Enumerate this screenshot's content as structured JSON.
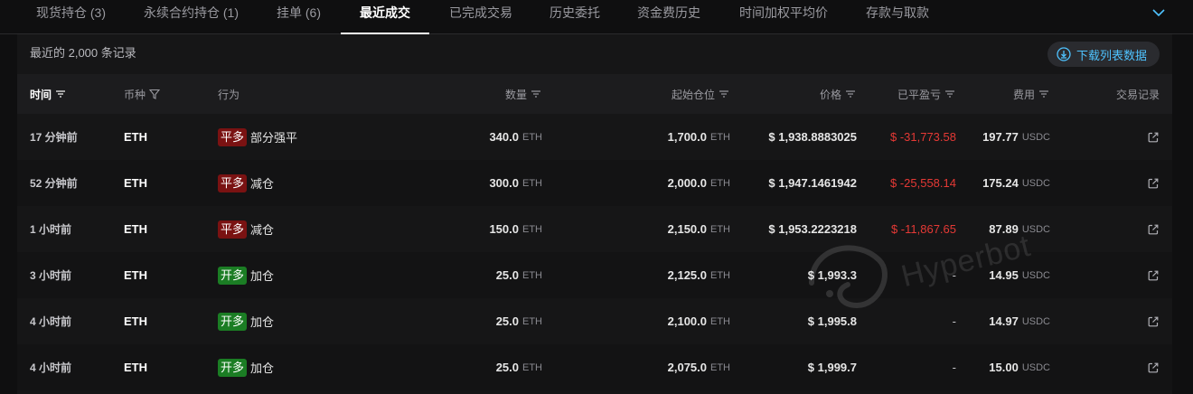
{
  "tabs": [
    {
      "label": "现货持仓 (3)",
      "active": false
    },
    {
      "label": "永续合约持仓 (1)",
      "active": false
    },
    {
      "label": "挂单 (6)",
      "active": false
    },
    {
      "label": "最近成交",
      "active": true
    },
    {
      "label": "已完成交易",
      "active": false
    },
    {
      "label": "历史委托",
      "active": false
    },
    {
      "label": "资金费历史",
      "active": false
    },
    {
      "label": "时间加权平均价",
      "active": false
    },
    {
      "label": "存款与取款",
      "active": false
    }
  ],
  "records_count": "最近的 2,000 条记录",
  "download_label": "下载列表数据",
  "columns": {
    "time": "时间",
    "coin": "币种",
    "action": "行为",
    "quantity": "数量",
    "start_position": "起始仓位",
    "price": "价格",
    "pnl": "已平盈亏",
    "fee": "费用",
    "trade_log": "交易记录"
  },
  "rows": [
    {
      "time": "17 分钟前",
      "coin": "ETH",
      "badge": "平多",
      "badge_type": "close",
      "action": "部分强平",
      "qty": "340.0",
      "qty_unit": "ETH",
      "start": "1,700.0",
      "start_unit": "ETH",
      "price": "$ 1,938.8883025",
      "pnl": "$ -31,773.58",
      "fee": "197.77",
      "fee_unit": "USDC"
    },
    {
      "time": "52 分钟前",
      "coin": "ETH",
      "badge": "平多",
      "badge_type": "close",
      "action": "减仓",
      "qty": "300.0",
      "qty_unit": "ETH",
      "start": "2,000.0",
      "start_unit": "ETH",
      "price": "$ 1,947.1461942",
      "pnl": "$ -25,558.14",
      "fee": "175.24",
      "fee_unit": "USDC"
    },
    {
      "time": "1 小时前",
      "coin": "ETH",
      "badge": "平多",
      "badge_type": "close",
      "action": "减仓",
      "qty": "150.0",
      "qty_unit": "ETH",
      "start": "2,150.0",
      "start_unit": "ETH",
      "price": "$ 1,953.2223218",
      "pnl": "$ -11,867.65",
      "fee": "87.89",
      "fee_unit": "USDC"
    },
    {
      "time": "3 小时前",
      "coin": "ETH",
      "badge": "开多",
      "badge_type": "open",
      "action": "加仓",
      "qty": "25.0",
      "qty_unit": "ETH",
      "start": "2,125.0",
      "start_unit": "ETH",
      "price": "$ 1,993.3",
      "pnl": "-",
      "fee": "14.95",
      "fee_unit": "USDC"
    },
    {
      "time": "4 小时前",
      "coin": "ETH",
      "badge": "开多",
      "badge_type": "open",
      "action": "加仓",
      "qty": "25.0",
      "qty_unit": "ETH",
      "start": "2,100.0",
      "start_unit": "ETH",
      "price": "$ 1,995.8",
      "pnl": "-",
      "fee": "14.97",
      "fee_unit": "USDC"
    },
    {
      "time": "4 小时前",
      "coin": "ETH",
      "badge": "开多",
      "badge_type": "open",
      "action": "加仓",
      "qty": "25.0",
      "qty_unit": "ETH",
      "start": "2,075.0",
      "start_unit": "ETH",
      "price": "$ 1,999.7",
      "pnl": "-",
      "fee": "15.00",
      "fee_unit": "USDC"
    }
  ],
  "watermark": "Hyperbot",
  "colors": {
    "background": "#0f0f10",
    "panel": "#161617",
    "loss": "#e53935",
    "badge_close": "#7a1212",
    "badge_open": "#1b7d24",
    "accent": "#4fc3ff"
  }
}
